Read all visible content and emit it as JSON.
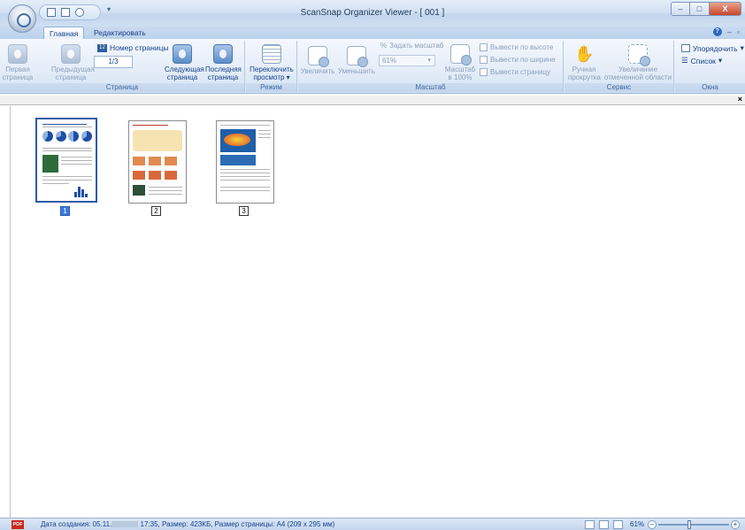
{
  "window": {
    "title": "ScanSnap Organizer Viewer - [ 001 ]",
    "controls": {
      "minimize": "–",
      "maximize": "□",
      "close": "X"
    }
  },
  "tabs": [
    {
      "label": "Главная",
      "active": true
    },
    {
      "label": "Редактировать",
      "active": false
    }
  ],
  "ribbon": {
    "page_group": {
      "label": "Страница",
      "first": "Первая страница",
      "prev": "Предыдущая страница",
      "page_number_label": "Номер страницы",
      "page_number_value": "1/3",
      "next": "Следующая страница",
      "last": "Последняя страница"
    },
    "mode_group": {
      "label": "Режим",
      "switch": "Переключить просмотр"
    },
    "scale_group": {
      "label": "Масштаб",
      "zoom_in": "Увеличить",
      "zoom_out": "Уменьшить",
      "set_scale_label": "Задать масштаб",
      "scale_value": "61%",
      "scale100": "Масштаб в 100%",
      "fit_height": "Вывести по высоте",
      "fit_width": "Вывести по ширине",
      "fit_page": "Вывести страницу"
    },
    "service_group": {
      "label": "Сервис",
      "hand": "Ручная прокрутка",
      "zoom_area": "Увеличение отмеченной области"
    },
    "windows_group": {
      "label": "Окна",
      "arrange": "Упорядочить",
      "list": "Список"
    }
  },
  "thumbnails": [
    {
      "number": "1",
      "selected": true
    },
    {
      "number": "2",
      "selected": false
    },
    {
      "number": "3",
      "selected": false
    }
  ],
  "status": {
    "text": "Дата создания: 05.11.",
    "text_rest": " 17:35, Размер: 423КБ, Размер страницы: А4 (209 x 295 мм)",
    "zoom": "61%",
    "badge": "PDF"
  },
  "colors": {
    "accent": "#15428b",
    "selection": "#3d7be0",
    "close": "#c8462a",
    "pdf": "#c9271c"
  }
}
